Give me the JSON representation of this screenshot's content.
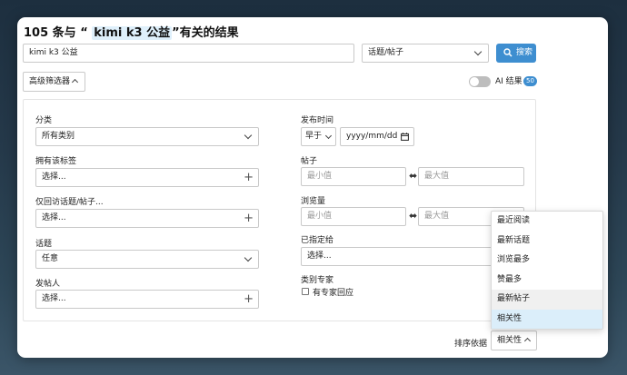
{
  "title": {
    "prefix": "105 条与 “ ",
    "query": "kimi k3 公益",
    "suffix": "”有关的结果"
  },
  "search": {
    "value": "kimi k3 公益",
    "type_value": "话题/帖子",
    "button_label": "搜索"
  },
  "advanced": {
    "label": "高级筛选器"
  },
  "ai": {
    "label": "AI 结果",
    "badge": "50",
    "enabled": false
  },
  "filters": {
    "category_label": "分类",
    "category_value": "所有类别",
    "tags_label": "拥有该标签",
    "tags_placeholder": "选择...",
    "only_label": "仅回访话题/帖子...",
    "only_placeholder": "选择...",
    "topic_label": "话题",
    "topic_value": "任意",
    "poster_label": "发帖人",
    "poster_placeholder": "选择...",
    "date_label": "发布时间",
    "date_op": "早于",
    "date_placeholder": "yyyy/mm/dd",
    "posts_label": "帖子",
    "posts_min": "最小值",
    "posts_max": "最大值",
    "views_label": "浏览量",
    "views_min": "最小值",
    "views_max": "最大值",
    "assigned_label": "已指定给",
    "assigned_placeholder": "选择...",
    "expert_label": "类别专家",
    "expert_checkbox_label": "有专家回应"
  },
  "sort": {
    "label": "排序依据",
    "value": "相关性",
    "options": [
      "最近阅读",
      "最新话题",
      "浏览最多",
      "赞最多",
      "最新帖子",
      "相关性"
    ],
    "hovered": "最新帖子",
    "selected": "相关性"
  },
  "colors": {
    "accent": "#3e8ed0",
    "highlight": "#dff0fb",
    "selected_option": "#dbeefa"
  }
}
